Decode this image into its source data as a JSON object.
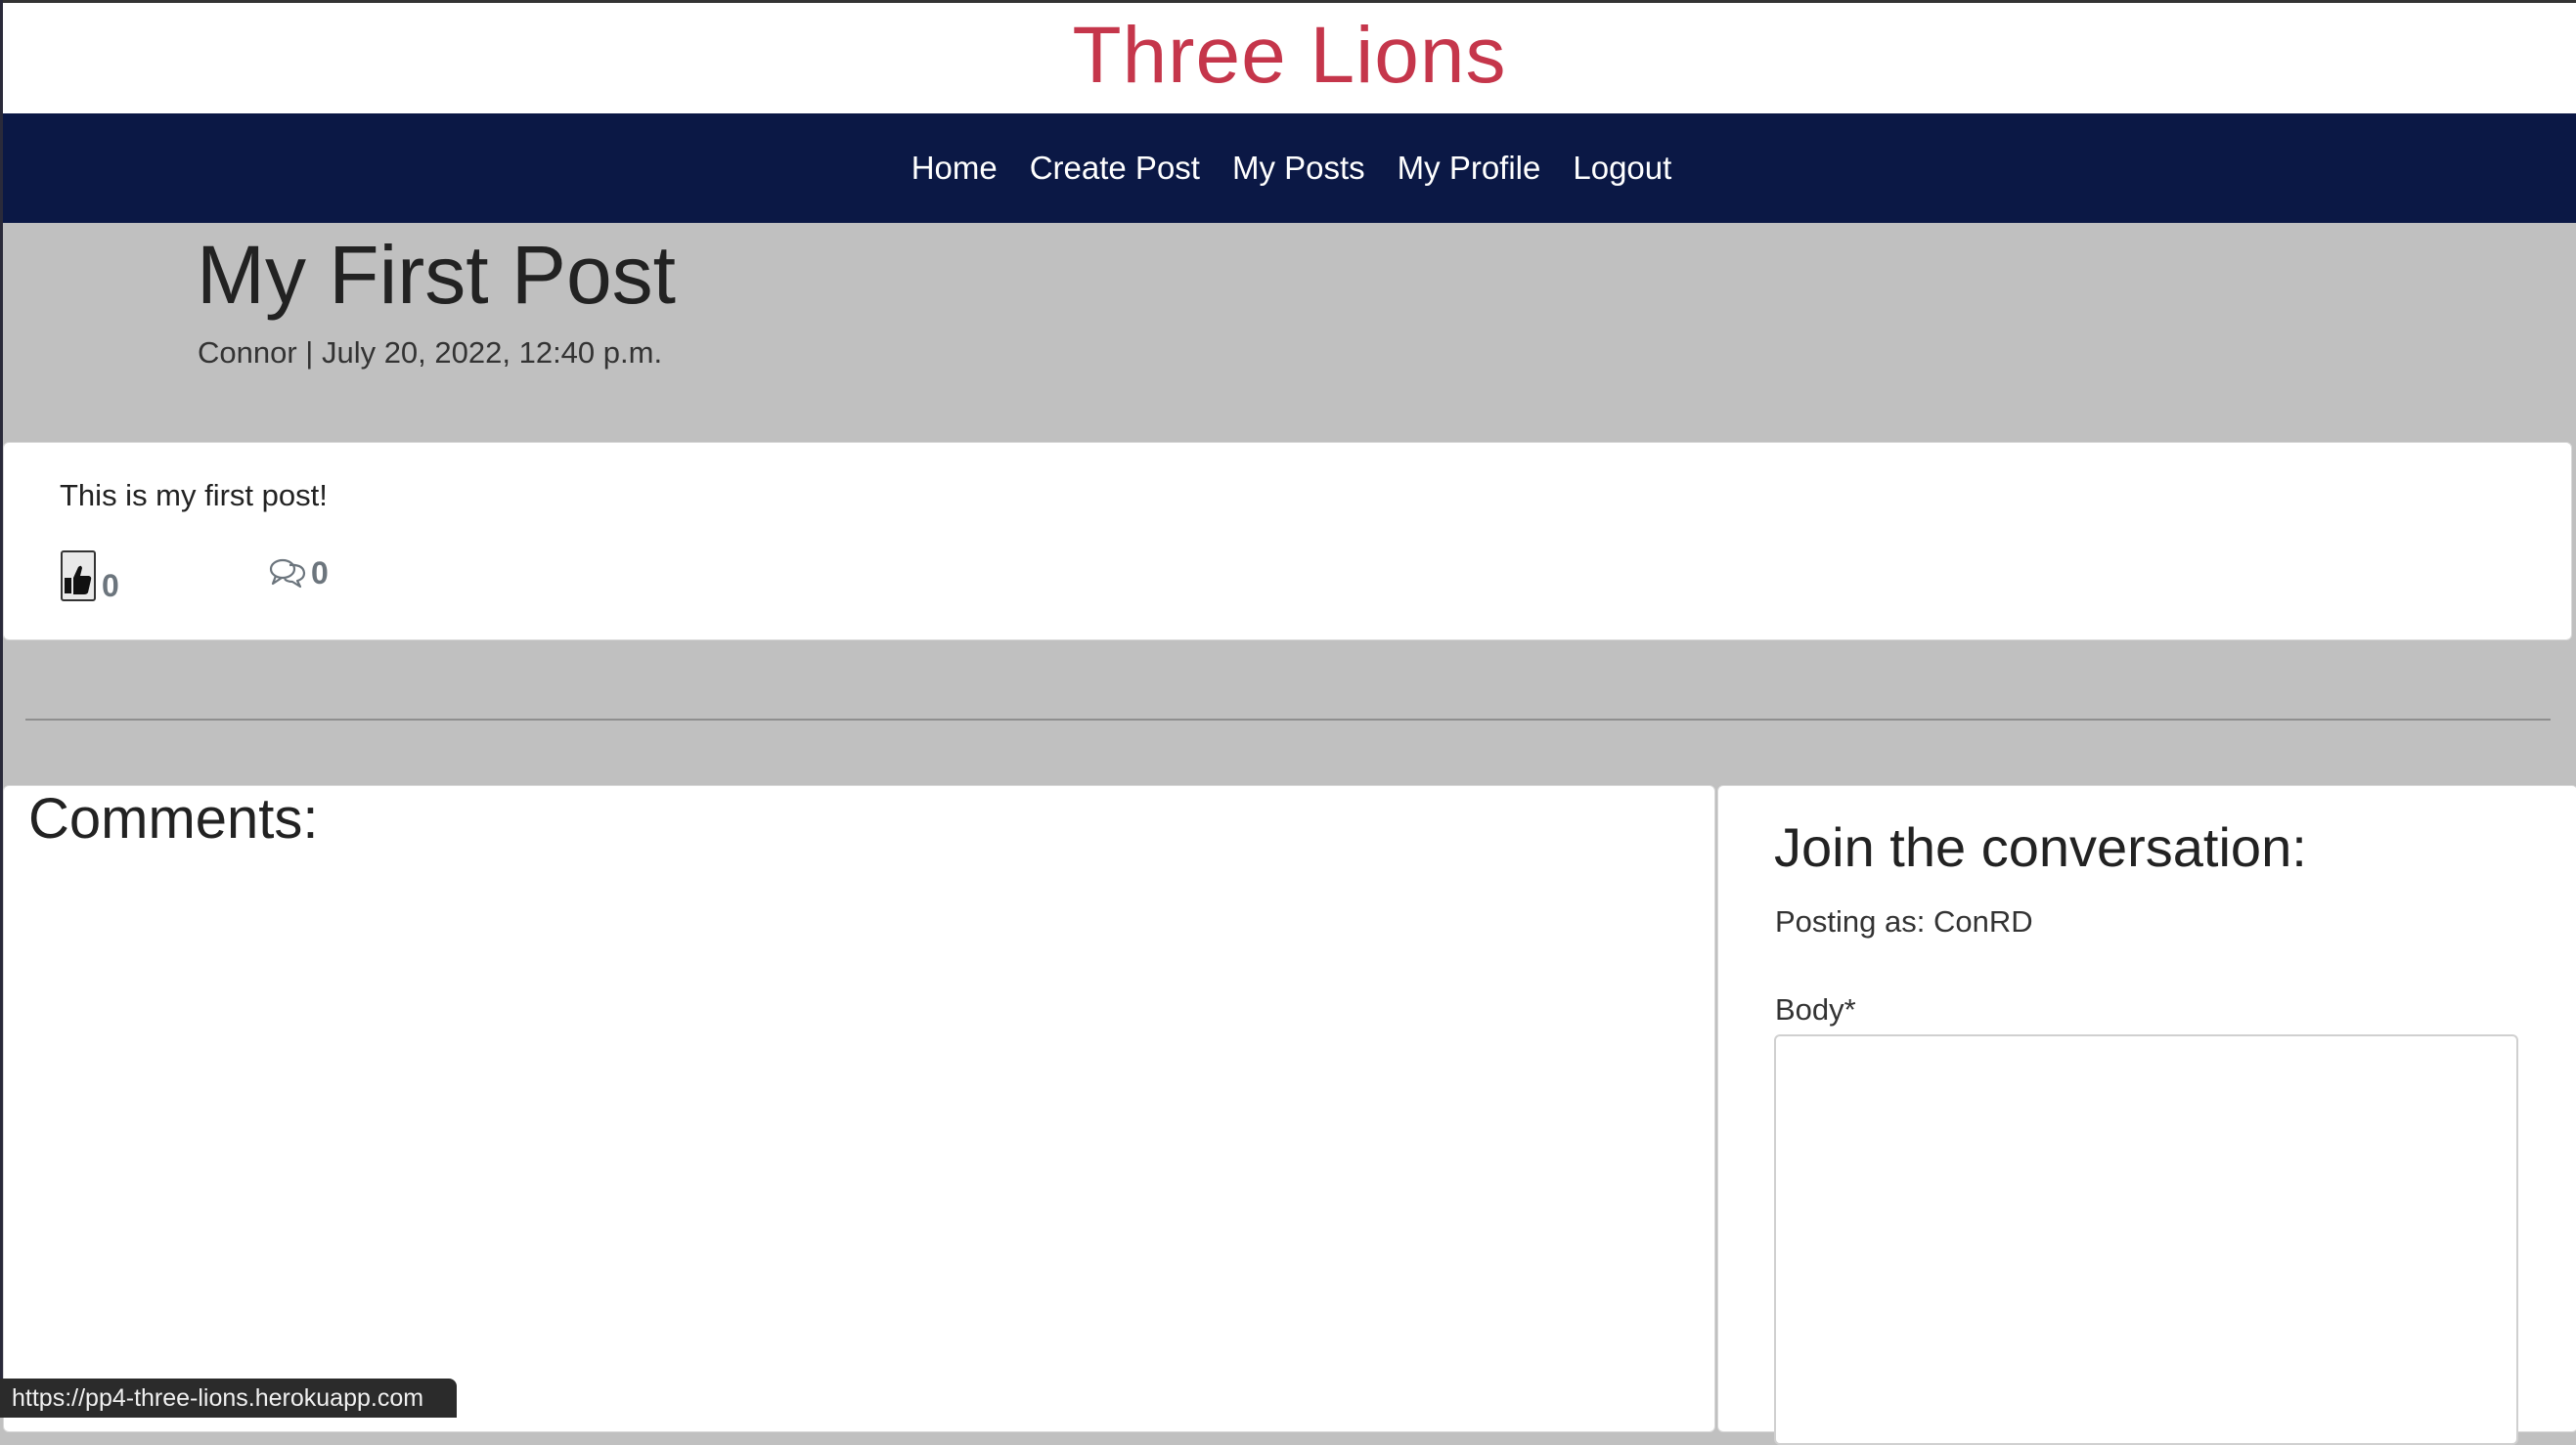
{
  "brand": {
    "title": "Three Lions",
    "color": "#c5364b"
  },
  "nav": {
    "background": "#0b1845",
    "items": [
      {
        "label": "Home"
      },
      {
        "label": "Create Post"
      },
      {
        "label": "My Posts"
      },
      {
        "label": "My Profile"
      },
      {
        "label": "Logout"
      }
    ]
  },
  "post": {
    "title": "My First Post",
    "meta": "Connor | July 20, 2022, 12:40 p.m.",
    "body": "This is my first post!",
    "like_icon": "thumbs-up-icon",
    "likes": "0",
    "comment_icon": "comments-icon",
    "comments": "0"
  },
  "comments_section": {
    "heading": "Comments:"
  },
  "comment_form": {
    "heading": "Join the conversation:",
    "posting_as": "Posting as: ConRD",
    "body_label": "Body*",
    "body_value": ""
  },
  "status_bar": {
    "url": "https://pp4-three-lions.herokuapp.com"
  }
}
